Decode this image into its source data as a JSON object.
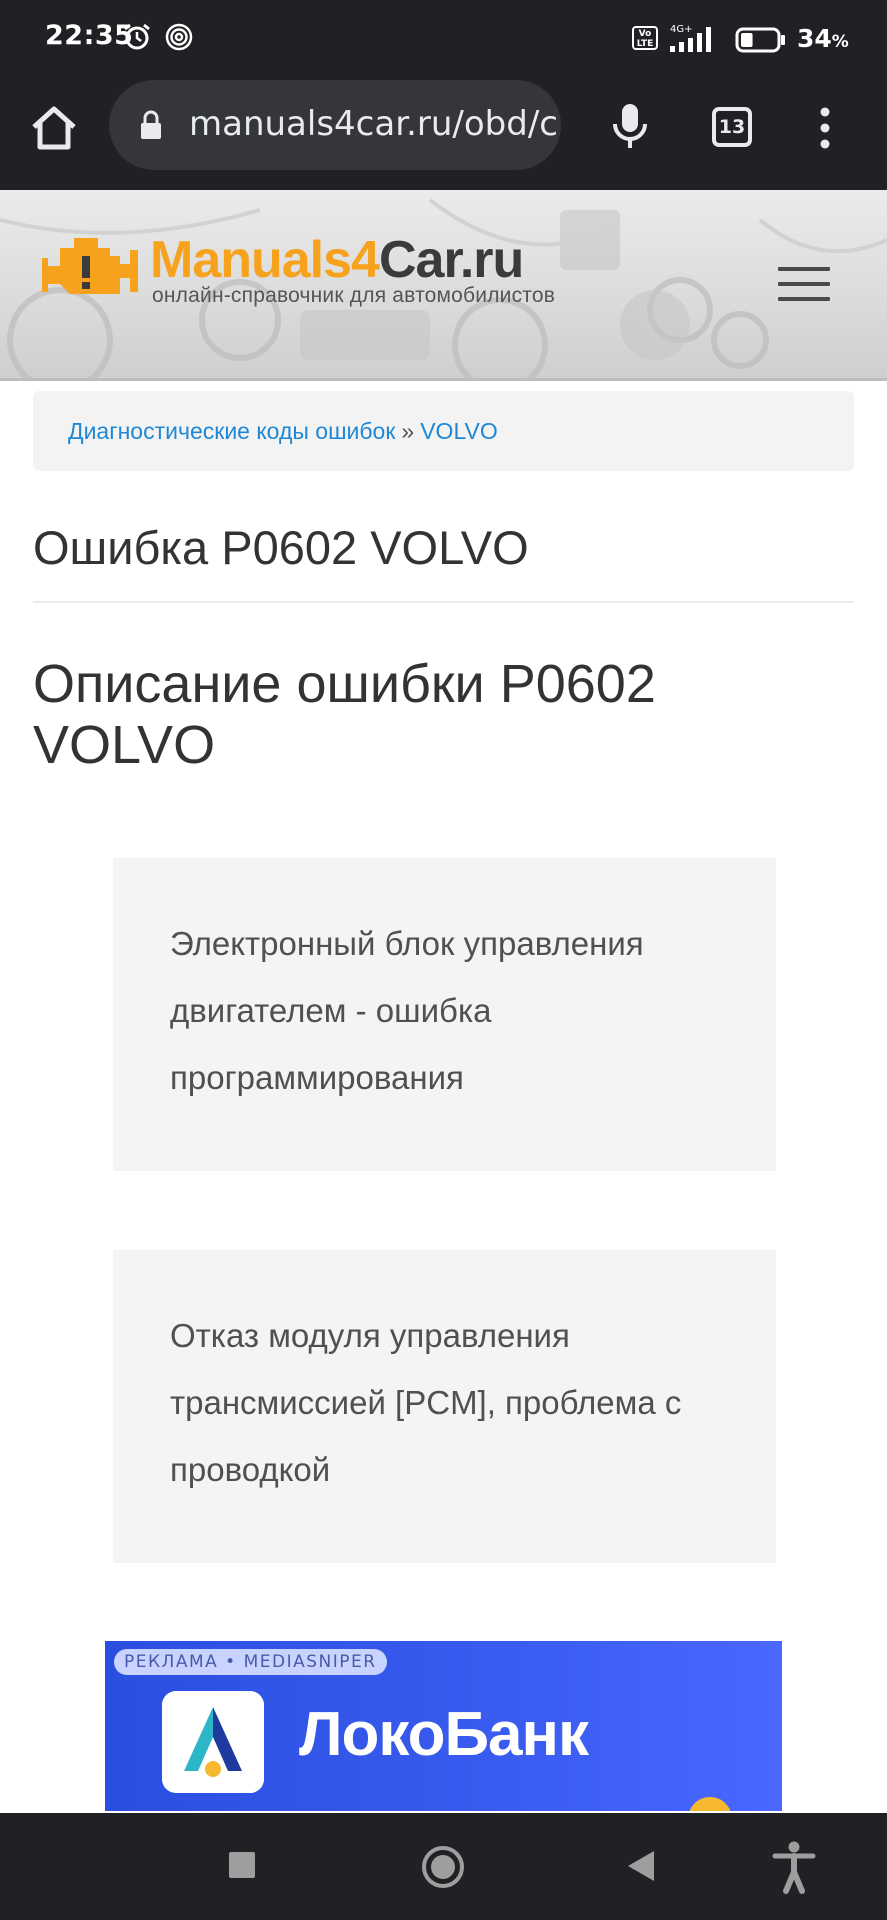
{
  "status_bar": {
    "time": "22:35",
    "volte_label": "Vo LTE",
    "network": "4G+",
    "battery_percent": "34",
    "battery_unit": "%",
    "battery_level": 0.34
  },
  "browser": {
    "url": "manuals4car.ru/obd/c",
    "tab_count": "13"
  },
  "site": {
    "logo_part1": "Manuals4",
    "logo_part2": "Car.ru",
    "tagline": "онлайн-справочник для автомобилистов"
  },
  "breadcrumb": {
    "items": [
      "Диагностические коды ошибок",
      "VOLVO"
    ],
    "separator": "»"
  },
  "page": {
    "title": "Ошибка P0602 VOLVO",
    "subtitle": "Описание ошибки P0602 VOLVO",
    "descriptions": [
      "Электронный блок управления двигателем - ошибка программирования",
      "Отказ модуля управления трансмиссией [PCM], проблема с проводкой"
    ]
  },
  "ad": {
    "label": "РЕКЛАМА • MEDIASNIPER",
    "brand": "ЛокоБанк"
  },
  "colors": {
    "link": "#1e88d6",
    "logo_orange": "#f6a21d",
    "ad_blue": "#3a5cf0",
    "system_bar": "#202124"
  },
  "icons": {
    "home": "home-icon",
    "lock": "lock-icon",
    "mic": "microphone-icon",
    "more": "more-vert-icon",
    "menu": "hamburger-menu-icon",
    "nav_recents": "square-recents-icon",
    "nav_home": "circle-home-icon",
    "nav_back": "triangle-back-icon",
    "accessibility": "accessibility-icon"
  }
}
